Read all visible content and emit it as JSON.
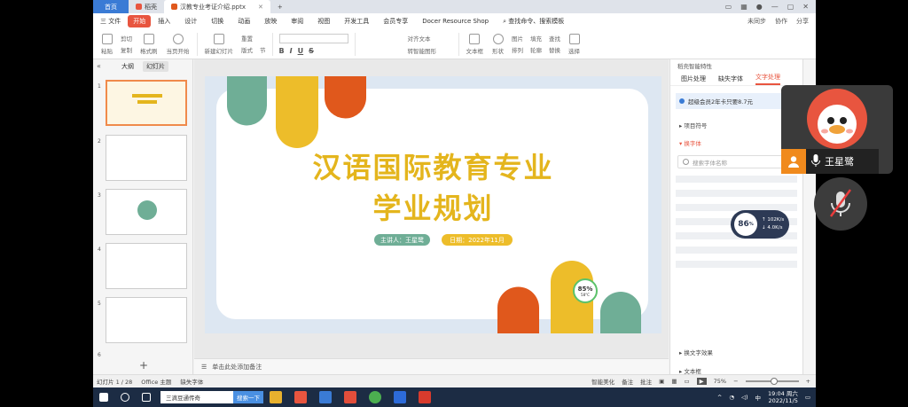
{
  "tabs": [
    {
      "label": "首页"
    },
    {
      "label": "稻壳"
    },
    {
      "label": "汉教专业考证介绍.pptx"
    }
  ],
  "menu": {
    "file": "三 文件",
    "items": [
      "开始",
      "插入",
      "设计",
      "切换",
      "动画",
      "放映",
      "审阅",
      "视图",
      "开发工具",
      "会员专享",
      "Docer Resource Shop"
    ],
    "search": "查找命令、搜索模板",
    "right": [
      "未同步",
      "协作",
      "分享"
    ]
  },
  "ribbon": {
    "paste": "粘贴",
    "cut": "剪切",
    "copy": "复制",
    "format_painter": "格式刷",
    "from_start": "当页开始",
    "new_slide": "新建幻灯片",
    "layout": "版式",
    "section": "节",
    "reset": "重置",
    "text_box": "文本框",
    "shape": "形状",
    "arrange": "排列",
    "find": "查找",
    "replace": "替换",
    "select": "选择",
    "picture": "图片",
    "fill": "填充",
    "outline": "轮廓",
    "align_text": "对齐文本",
    "smart_graphic": "转智能图形",
    "format_buttons": [
      "B",
      "I",
      "U",
      "S"
    ]
  },
  "left_panel": {
    "tabs": [
      "大纲",
      "幻灯片"
    ],
    "slide_numbers": [
      "1",
      "2",
      "3",
      "4",
      "5",
      "6"
    ],
    "add": "+"
  },
  "slide": {
    "title_line1": "汉语国际教育专业",
    "title_line2": "学业规划",
    "speaker": "主讲人：王星鹭",
    "date": "日期：2022年11月"
  },
  "weather": {
    "value": "85%",
    "sub": "58°C"
  },
  "notes": "单击此处添加备注",
  "right_panel": {
    "header": "稻壳智能特性",
    "tabs": [
      "图片处理",
      "缺失字体",
      "文字处理"
    ],
    "banner": "超级会员2年卡只要8.7元",
    "section1": "项目符号",
    "section2": "换字体",
    "search_placeholder": "搜索字体名称",
    "bottom1": "换文字效果",
    "bottom2": "文本框"
  },
  "status": {
    "slide_count": "幻灯片 1 / 28",
    "theme": "Office 主题",
    "missing_font": "缺失字体",
    "smart_beautify": "智能美化",
    "notes": "备注",
    "comments": "批注",
    "zoom": "75%"
  },
  "taskbar": {
    "search": "三滴豆通传奇",
    "search_btn": "搜索一下",
    "clock_time": "19:04 周六",
    "clock_date": "2022/11/5",
    "lang": "中"
  },
  "call": {
    "name": "王星鹭"
  },
  "speed": {
    "percent": "86",
    "unit": "%",
    "up": "102K/s",
    "down": "4.0K/s"
  },
  "colors": {
    "accent": "#e8553f",
    "title_gold": "#e4b51d",
    "green": "#6fae96",
    "orange": "#e0581c"
  }
}
